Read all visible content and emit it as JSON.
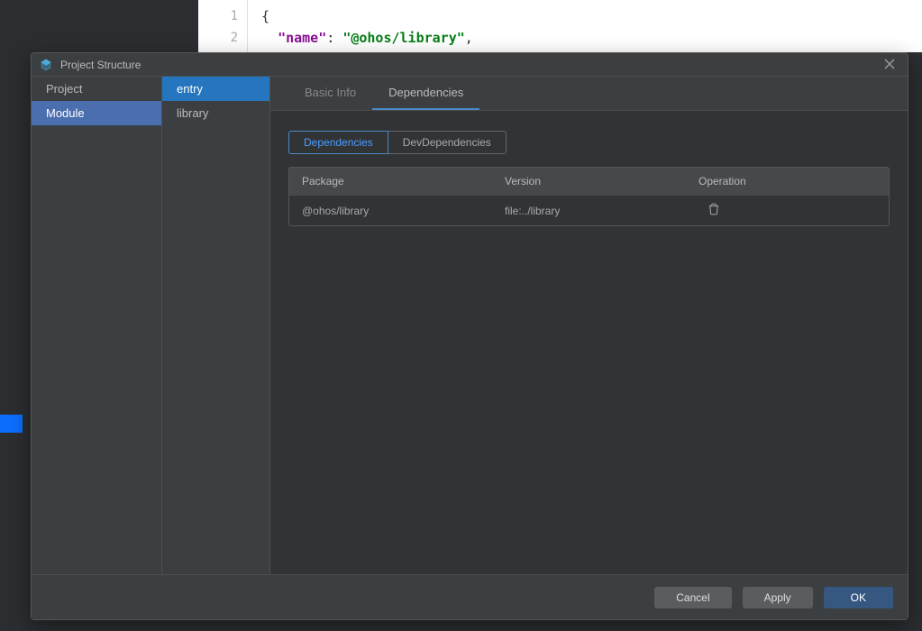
{
  "editor": {
    "line1_num": "1",
    "line2_num": "2",
    "line1_text": "{",
    "line2_key": "\"name\"",
    "line2_sep": ": ",
    "line2_val": "\"@ohos/library\"",
    "line2_end": ","
  },
  "dialog": {
    "title": "Project Structure",
    "sidebar": {
      "items": [
        {
          "label": "Project"
        },
        {
          "label": "Module"
        }
      ]
    },
    "second": {
      "items": [
        {
          "label": "entry"
        },
        {
          "label": "library"
        }
      ]
    },
    "tabs": [
      {
        "label": "Basic Info"
      },
      {
        "label": "Dependencies"
      }
    ],
    "subtabs": [
      {
        "label": "Dependencies"
      },
      {
        "label": "DevDependencies"
      }
    ],
    "table": {
      "headers": {
        "package": "Package",
        "version": "Version",
        "operation": "Operation"
      },
      "rows": [
        {
          "package": "@ohos/library",
          "version": "file:../library"
        }
      ]
    },
    "buttons": {
      "cancel": "Cancel",
      "apply": "Apply",
      "ok": "OK"
    }
  }
}
